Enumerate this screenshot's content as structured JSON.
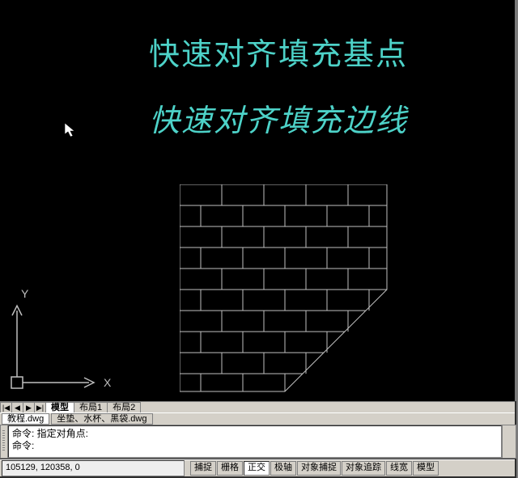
{
  "canvas": {
    "title1": "快速对齐填充基点",
    "title2": "快速对齐填充边线",
    "ucs": {
      "x_label": "X",
      "y_label": "Y"
    }
  },
  "tabs": {
    "nav": [
      "|◀",
      "◀",
      "▶",
      "▶|"
    ],
    "sheets": [
      {
        "label": "模型",
        "active": true
      },
      {
        "label": "布局1",
        "active": false
      },
      {
        "label": "布局2",
        "active": false
      }
    ]
  },
  "filetabs": [
    {
      "label": "教程.dwg",
      "active": true
    },
    {
      "label": "坐垫、水杯、黑袋.dwg",
      "active": false
    }
  ],
  "command": {
    "line1": "命令: 指定对角点:",
    "line2": "命令:"
  },
  "status": {
    "coords": "105129, 120358, 0",
    "buttons": [
      {
        "label": "捕捉",
        "pressed": false
      },
      {
        "label": "栅格",
        "pressed": false
      },
      {
        "label": "正交",
        "pressed": true
      },
      {
        "label": "极轴",
        "pressed": false
      },
      {
        "label": "对象捕捉",
        "pressed": false
      },
      {
        "label": "对象追踪",
        "pressed": false
      },
      {
        "label": "线宽",
        "pressed": false
      },
      {
        "label": "模型",
        "pressed": false
      }
    ]
  }
}
